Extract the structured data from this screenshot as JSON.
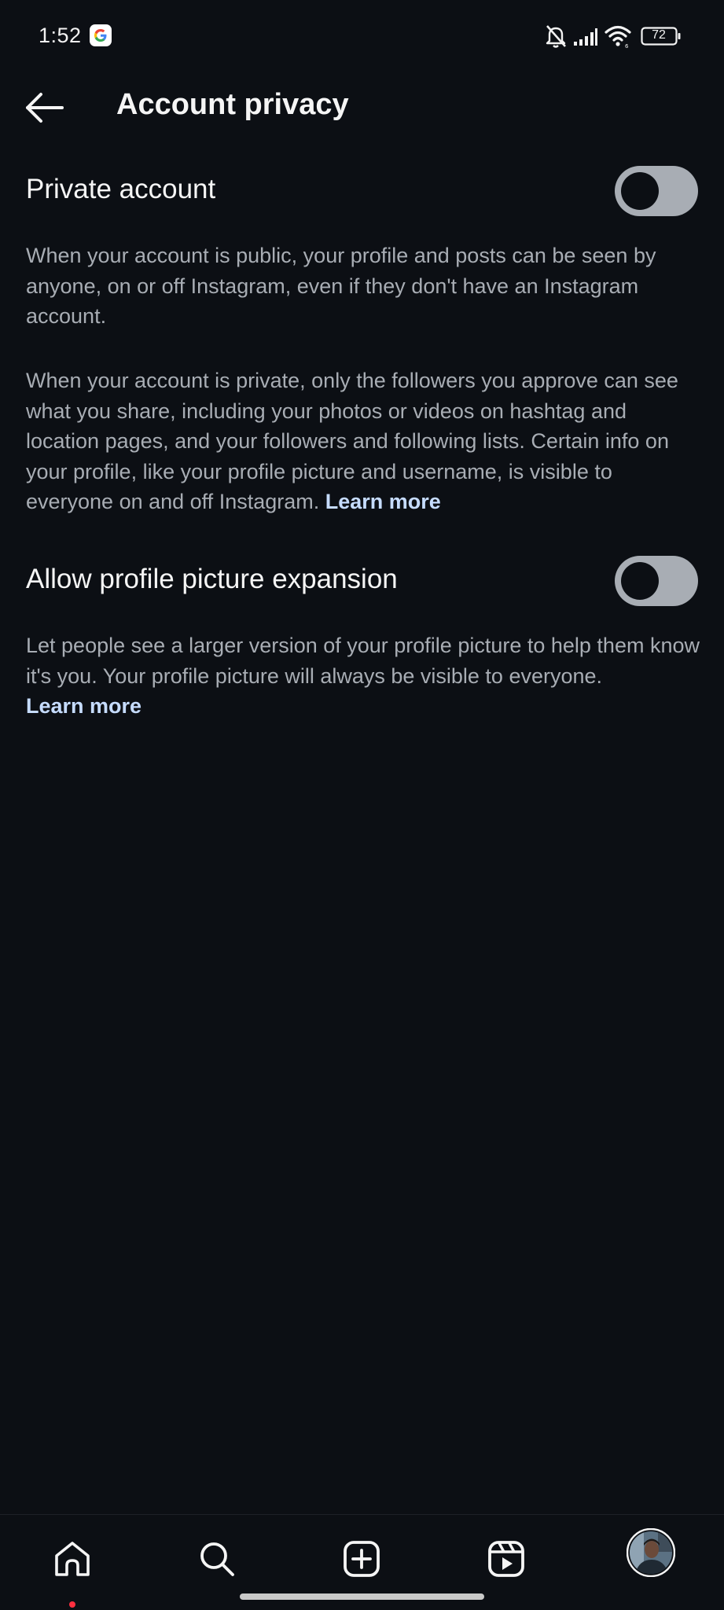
{
  "status_bar": {
    "time": "1:52",
    "battery_level": "72",
    "icons": [
      "google-icon",
      "notifications-muted-icon",
      "cellular-signal-icon",
      "wifi-icon",
      "battery-icon"
    ]
  },
  "header": {
    "title": "Account privacy"
  },
  "settings": {
    "private_account": {
      "label": "Private account",
      "enabled": false,
      "description_public": "When your account is public, your profile and posts can be seen by anyone, on or off Instagram, even if they don't have an Instagram account.",
      "description_private": "When your account is private, only the followers you approve can see what you share, including your photos or videos on hashtag and location pages, and your followers and following lists. Certain info on your profile, like your profile picture and username, is visible to everyone on and off Instagram.",
      "learn_more": "Learn more"
    },
    "profile_picture_expansion": {
      "label": "Allow profile picture expansion",
      "enabled": false,
      "description": "Let people see a larger version of your profile picture to help them know it's you. Your profile picture will always be visible to everyone.",
      "learn_more": "Learn more"
    }
  },
  "bottom_nav": {
    "items": [
      "home-icon",
      "search-icon",
      "create-icon",
      "reels-icon",
      "profile-avatar"
    ]
  },
  "colors": {
    "background": "#0c0f14",
    "text_primary": "#f5f5f5",
    "text_secondary": "#a8adb4",
    "link": "#c6dcff",
    "toggle_off": "#a8adb4",
    "notification_dot": "#ff3040"
  }
}
